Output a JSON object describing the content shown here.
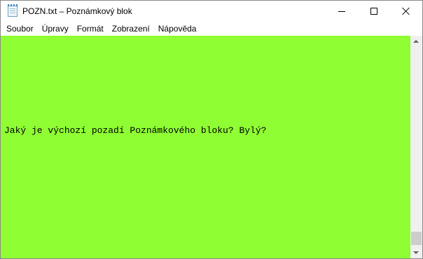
{
  "window": {
    "title": "POZN.txt – Poznámkový blok",
    "app_icon": "notepad-icon",
    "controls": [
      "minimize-icon",
      "maximize-icon",
      "close-icon"
    ]
  },
  "menu": {
    "items": [
      "Soubor",
      "Úpravy",
      "Formát",
      "Zobrazení",
      "Nápověda"
    ]
  },
  "editor": {
    "content": "Jaký je výchozí pozadí Poznámkového bloku? Bylý?",
    "background_color": "#8ffe33",
    "text_color": "#000000"
  },
  "scrollbar": {
    "up_icon": "chevron-up-icon",
    "down_icon": "chevron-down-icon"
  }
}
